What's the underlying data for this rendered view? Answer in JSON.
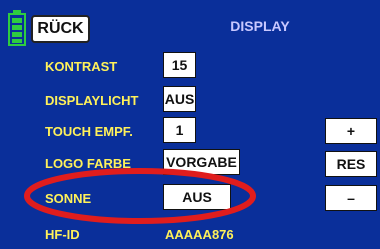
{
  "header": {
    "back_label": "RÜCK",
    "title": "DISPLAY"
  },
  "rows": [
    {
      "label": "KONTRAST",
      "value": "15"
    },
    {
      "label": "DISPLAYLICHT",
      "value": "AUS"
    },
    {
      "label": "TOUCH EMPF.",
      "value": "1"
    },
    {
      "label": "LOGO FARBE",
      "value": "VORGABE"
    },
    {
      "label": "SONNE",
      "value": "AUS"
    },
    {
      "label": "HF-ID",
      "value": "AAAAA876"
    }
  ],
  "side_buttons": {
    "plus": "+",
    "reset": "RES",
    "minus": "–"
  },
  "colors": {
    "background": "#0a2f9a",
    "label": "#fff15a",
    "highlight_ring": "#e01d1d",
    "battery": "#2ecc40"
  },
  "icons": {
    "battery": "battery-icon"
  }
}
